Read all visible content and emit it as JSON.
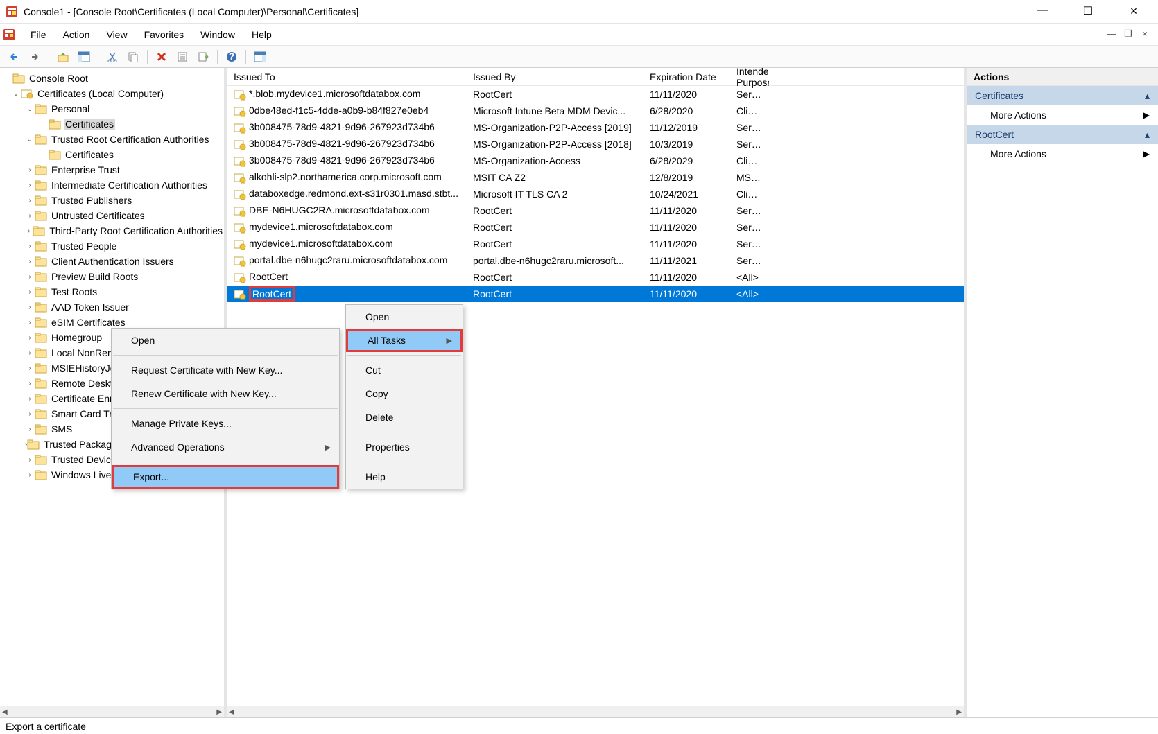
{
  "window": {
    "title": "Console1 - [Console Root\\Certificates (Local Computer)\\Personal\\Certificates]"
  },
  "menubar": {
    "file": "File",
    "action": "Action",
    "view": "View",
    "favorites": "Favorites",
    "window": "Window",
    "help": "Help"
  },
  "tree": {
    "root": "Console Root",
    "cert_local": "Certificates (Local Computer)",
    "personal": "Personal",
    "personal_certs": "Certificates",
    "trca": "Trusted Root Certification Authorities",
    "trca_certs": "Certificates",
    "enterprise_trust": "Enterprise Trust",
    "int_ca": "Intermediate Certification Authorities",
    "trusted_publishers": "Trusted Publishers",
    "untrusted_certs": "Untrusted Certificates",
    "third_party": "Third-Party Root Certification Authorities",
    "trusted_people": "Trusted People",
    "client_auth": "Client Authentication Issuers",
    "preview_build": "Preview Build Roots",
    "test_roots": "Test Roots",
    "aad_token": "AAD Token Issuer",
    "esim": "eSIM Certificates",
    "homegroup": "Homegroup",
    "local_nonr": "Local NonRemovable Certificates",
    "msiehistory": "MSIEHistoryJournal",
    "remote_desktop": "Remote Desktop",
    "cert_enrollment": "Certificate Enrollment Requests",
    "smart_card": "Smart Card Trusted Roots",
    "sms": "SMS",
    "trusted_packaged": "Trusted Packaged App Installation Authorities",
    "trusted_devices": "Trusted Devices",
    "winlive": "Windows Live ID Token Issuer"
  },
  "columns": {
    "issued_to": "Issued To",
    "issued_by": "Issued By",
    "expiration": "Expiration Date",
    "intended": "Intended Purposes"
  },
  "rows": [
    {
      "issued_to": "*.blob.mydevice1.microsoftdatabox.com",
      "issued_by": "RootCert",
      "exp": "11/11/2020",
      "intended": "Server Authentication"
    },
    {
      "issued_to": "0dbe48ed-f1c5-4dde-a0b9-b84f827e0eb4",
      "issued_by": "Microsoft Intune Beta MDM Devic...",
      "exp": "6/28/2020",
      "intended": "Client Authentication"
    },
    {
      "issued_to": "3b008475-78d9-4821-9d96-267923d734b6",
      "issued_by": "MS-Organization-P2P-Access [2019]",
      "exp": "11/12/2019",
      "intended": "Server Authentication"
    },
    {
      "issued_to": "3b008475-78d9-4821-9d96-267923d734b6",
      "issued_by": "MS-Organization-P2P-Access [2018]",
      "exp": "10/3/2019",
      "intended": "Server Authentication"
    },
    {
      "issued_to": "3b008475-78d9-4821-9d96-267923d734b6",
      "issued_by": "MS-Organization-Access",
      "exp": "6/28/2029",
      "intended": "Client Authentication"
    },
    {
      "issued_to": "alkohli-slp2.northamerica.corp.microsoft.com",
      "issued_by": "MSIT CA Z2",
      "exp": "12/8/2019",
      "intended": "MS-WiFi"
    },
    {
      "issued_to": "databoxedge.redmond.ext-s31r0301.masd.stbt...",
      "issued_by": "Microsoft IT TLS CA 2",
      "exp": "10/24/2021",
      "intended": "Client Authentication"
    },
    {
      "issued_to": "DBE-N6HUGC2RA.microsoftdatabox.com",
      "issued_by": "RootCert",
      "exp": "11/11/2020",
      "intended": "Server Authentication"
    },
    {
      "issued_to": "mydevice1.microsoftdatabox.com",
      "issued_by": "RootCert",
      "exp": "11/11/2020",
      "intended": "Server Authentication"
    },
    {
      "issued_to": "mydevice1.microsoftdatabox.com",
      "issued_by": "RootCert",
      "exp": "11/11/2020",
      "intended": "Server Authentication"
    },
    {
      "issued_to": "portal.dbe-n6hugc2raru.microsoftdatabox.com",
      "issued_by": "portal.dbe-n6hugc2raru.microsoft...",
      "exp": "11/11/2021",
      "intended": "Server Authentication"
    },
    {
      "issued_to": "RootCert",
      "issued_by": "RootCert",
      "exp": "11/11/2020",
      "intended": "<All>"
    },
    {
      "issued_to": "RootCert",
      "issued_by": "RootCert",
      "exp": "11/11/2020",
      "intended": "<All>",
      "selected": true,
      "redbox": true
    }
  ],
  "context_menu_1": {
    "open": "Open",
    "all_tasks": "All Tasks",
    "cut": "Cut",
    "copy": "Copy",
    "delete": "Delete",
    "properties": "Properties",
    "help": "Help"
  },
  "context_menu_2": {
    "open": "Open",
    "request_new_key": "Request Certificate with New Key...",
    "renew_new_key": "Renew Certificate with New Key...",
    "manage_private_keys": "Manage Private Keys...",
    "advanced_ops": "Advanced Operations",
    "export": "Export..."
  },
  "actions": {
    "header": "Actions",
    "group1": "Certificates",
    "more1": "More Actions",
    "group2": "RootCert",
    "more2": "More Actions"
  },
  "statusbar": {
    "text": "Export a certificate"
  }
}
